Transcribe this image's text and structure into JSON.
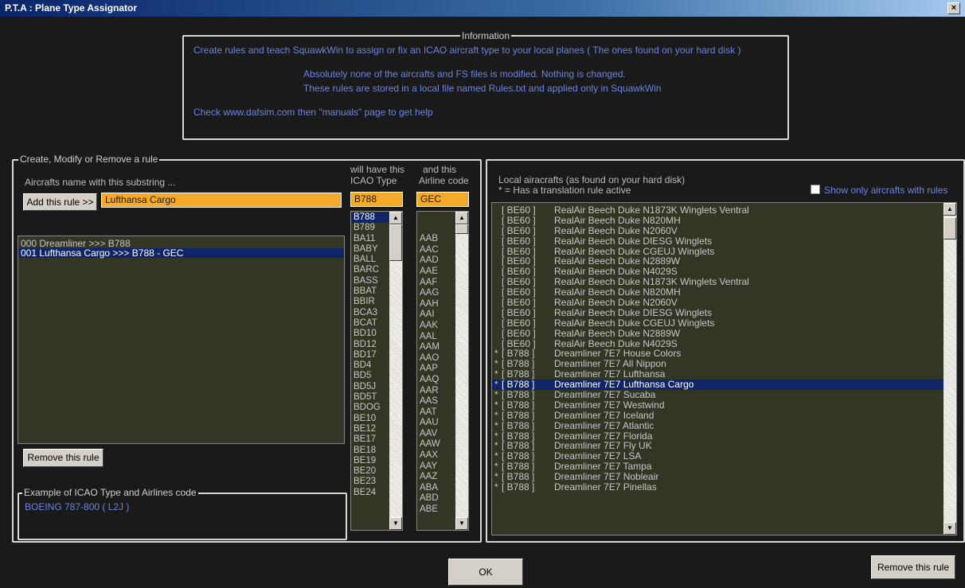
{
  "window": {
    "title": "P.T.A  : Plane Type Assignator"
  },
  "info": {
    "legend": "Information",
    "line1": "Create rules and teach SquawkWin to assign or fix an ICAO aircraft type to your local planes ( The ones found on your hard disk )",
    "line2": "Absolutely none of the aircrafts and FS files is modified.     Nothing is changed.",
    "line3": "These rules are stored in a local file named Rules.txt and applied only in SquawkWin",
    "line4": "Check www.dafsim.com   then \"manuals\" page to get help"
  },
  "rule_panel": {
    "legend": "Create, Modify or Remove a rule",
    "substring_label": "Aircrafts name with this substring ...",
    "add_button": "Add this rule >>",
    "substring_value": "Lufthansa Cargo",
    "icao_header_1": "will have this",
    "icao_header_2": "ICAO Type",
    "airline_header_1": "and this",
    "airline_header_2": "Airline code",
    "icao_value": "B788",
    "airline_value": "GEC",
    "rules": [
      "000  Dreamliner >>> B788",
      "001  Lufthansa Cargo >>> B788 - GEC"
    ],
    "selected_rule": 1,
    "remove_button": "Remove this rule",
    "example_legend": "Example of ICAO Type and Airlines code",
    "example_value": "BOEING 787-800 ( L2J )",
    "icao_types": [
      "B788",
      "B789",
      "BA11",
      "BABY",
      "BALL",
      "BARC",
      "BASS",
      "BBAT",
      "BBIR",
      "BCA3",
      "BCAT",
      "BD10",
      "BD12",
      "BD17",
      "BD4",
      "BD5",
      "BD5J",
      "BD5T",
      "BDOG",
      "BE10",
      "BE12",
      "BE17",
      "BE18",
      "BE19",
      "BE20",
      "BE23",
      "BE24"
    ],
    "selected_icao": 0,
    "airline_codes": [
      "",
      "",
      "AAB",
      "AAC",
      "AAD",
      "AAE",
      "AAF",
      "AAG",
      "AAH",
      "AAI",
      "AAK",
      "AAL",
      "AAM",
      "AAO",
      "AAP",
      "AAQ",
      "AAR",
      "AAS",
      "AAT",
      "AAU",
      "AAV",
      "AAW",
      "AAX",
      "AAY",
      "AAZ",
      "ABA",
      "ABD",
      "ABE"
    ]
  },
  "aircraft_panel": {
    "label_1": "Local airacrafts (as found on your hard disk)",
    "label_2": "* = Has a translation rule active",
    "checkbox_label": "Show only aircrafts with rules",
    "selected": 18,
    "items": [
      {
        "mark": "",
        "code": "[ BE60 ]",
        "name": "RealAir Beech Duke N1873K Winglets Ventral"
      },
      {
        "mark": "",
        "code": "[ BE60 ]",
        "name": "RealAir Beech Duke N820MH"
      },
      {
        "mark": "",
        "code": "[ BE60 ]",
        "name": "RealAir Beech Duke N2060V"
      },
      {
        "mark": "",
        "code": "[ BE60 ]",
        "name": "RealAir Beech Duke DIESG Winglets"
      },
      {
        "mark": "",
        "code": "[ BE60 ]",
        "name": "RealAir Beech Duke CGEUJ Winglets"
      },
      {
        "mark": "",
        "code": "[ BE60 ]",
        "name": "RealAir Beech Duke N2889W"
      },
      {
        "mark": "",
        "code": "[ BE60 ]",
        "name": "RealAir Beech Duke N4029S"
      },
      {
        "mark": "",
        "code": "[ BE60 ]",
        "name": "RealAir Beech Duke N1873K Winglets Ventral"
      },
      {
        "mark": "",
        "code": "[ BE60 ]",
        "name": "RealAir Beech Duke N820MH"
      },
      {
        "mark": "",
        "code": "[ BE60 ]",
        "name": "RealAir Beech Duke N2060V"
      },
      {
        "mark": "",
        "code": "[ BE60 ]",
        "name": "RealAir Beech Duke DIESG Winglets"
      },
      {
        "mark": "",
        "code": "[ BE60 ]",
        "name": "RealAir Beech Duke CGEUJ Winglets"
      },
      {
        "mark": "",
        "code": "[ BE60 ]",
        "name": "RealAir Beech Duke N2889W"
      },
      {
        "mark": "",
        "code": "[ BE60 ]",
        "name": "RealAir Beech Duke N4029S"
      },
      {
        "mark": "*",
        "code": "[ B788 ]",
        "name": "Dreamliner 7E7 House Colors"
      },
      {
        "mark": "*",
        "code": "[ B788 ]",
        "name": "Dreamliner 7E7 All Nippon"
      },
      {
        "mark": "*",
        "code": "[ B788 ]",
        "name": "Dreamliner 7E7 Lufthansa"
      },
      {
        "mark": "*",
        "code": "[ B788 ]",
        "name": "Dreamliner 7E7 Lufthansa Cargo"
      },
      {
        "mark": "*",
        "code": "[ B788 ]",
        "name": "Dreamliner 7E7 Sucaba"
      },
      {
        "mark": "*",
        "code": "[ B788 ]",
        "name": "Dreamliner 7E7 Westwind"
      },
      {
        "mark": "*",
        "code": "[ B788 ]",
        "name": "Dreamliner 7E7 Iceland"
      },
      {
        "mark": "*",
        "code": "[ B788 ]",
        "name": "Dreamliner 7E7 Atlantic"
      },
      {
        "mark": "*",
        "code": "[ B788 ]",
        "name": "Dreamliner 7E7 Florida"
      },
      {
        "mark": "*",
        "code": "[ B788 ]",
        "name": "Dreamliner 7E7 Fly UK"
      },
      {
        "mark": "*",
        "code": "[ B788 ]",
        "name": "Dreamliner 7E7 LSA"
      },
      {
        "mark": "*",
        "code": "[ B788 ]",
        "name": "Dreamliner 7E7 Tampa"
      },
      {
        "mark": "*",
        "code": "[ B788 ]",
        "name": "Dreamliner 7E7 Nobleair"
      },
      {
        "mark": "*",
        "code": "[ B788 ]",
        "name": "Dreamliner 7E7 Pinellas"
      }
    ],
    "remove_button": "Remove this rule"
  },
  "ok_button": "OK",
  "colors": {
    "accent_orange": "#f5a92a",
    "list_bg": "#333525",
    "selection": "#10246a",
    "info_text": "#6c84e0"
  }
}
